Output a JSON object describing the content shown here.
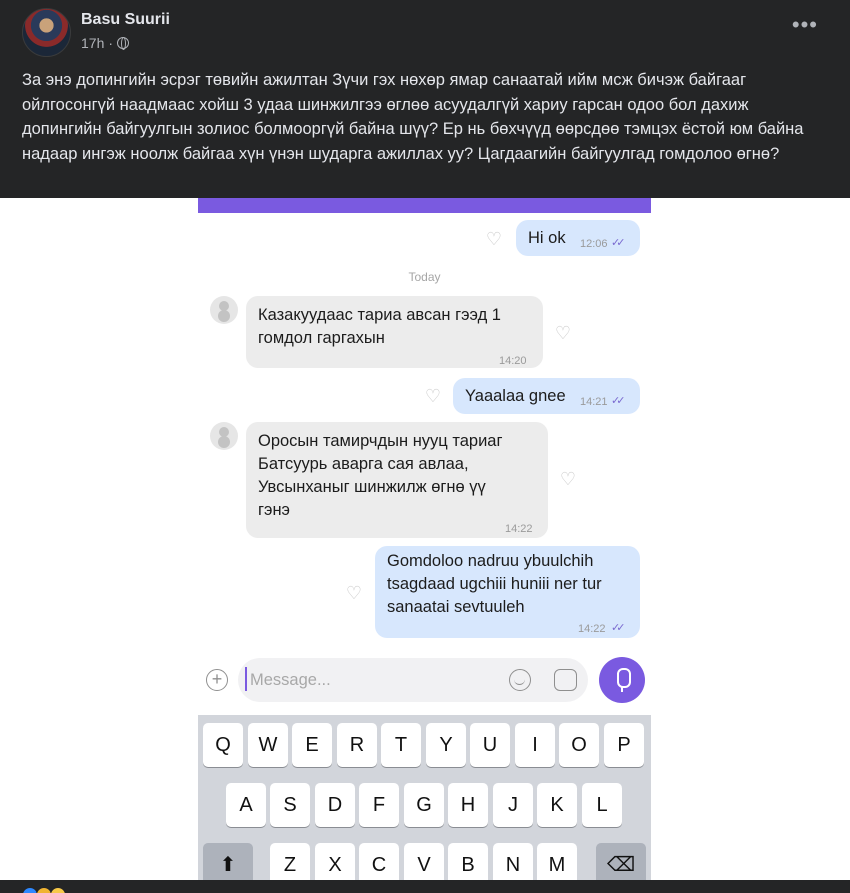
{
  "post": {
    "author": "Basu Suurii",
    "time": "17h",
    "text": "За энэ допингийн эсрэг төвийн ажилтан Зүчи гэх нөхөр ямар санаатай ийм мсж бичэж байгааг ойлгосонгүй наадмаас хойш 3 удаа шинжилгээ өглөө асуудалгүй хариу гарсан одоо бол дахиж допингийн байгуулгын золиос болмооргүй байна шүү? Ер нь бөхчүүд өөрсдөө тэмцэх ёстой юм байна надаар ингэж ноолж байгаа хүн үнэн шударга ажиллах уу? Цагдаагийн байгуулгад гомдолоо өгнө?"
  },
  "chat": {
    "day_label": "Today",
    "messages": [
      {
        "dir": "out",
        "text": "Hi ok",
        "time": "12:06"
      },
      {
        "dir": "in",
        "lines": [
          "Казакуудаас тариа авсан гээд 1",
          "гомдол гаргахын"
        ],
        "time": "14:20"
      },
      {
        "dir": "out",
        "text": "Yaaalaa gnee",
        "time": "14:21"
      },
      {
        "dir": "in",
        "lines": [
          "Оросын тамирчдын нууц тариаг",
          "Батсуурь аварга сая авлаа,",
          "Увсынханыг шинжилж өгнө үү",
          "гэнэ"
        ],
        "time": "14:22"
      },
      {
        "dir": "out",
        "lines": [
          "Gomdoloo nadruu ybuulchih",
          "tsagdaad ugchiii huniii ner tur",
          "sanaatai sevtuuleh"
        ],
        "time": "14:22"
      }
    ],
    "composer_placeholder": "Message...",
    "keyboard": {
      "row1": [
        "Q",
        "W",
        "E",
        "R",
        "T",
        "Y",
        "U",
        "I",
        "O",
        "P"
      ],
      "row2": [
        "A",
        "S",
        "D",
        "F",
        "G",
        "H",
        "J",
        "K",
        "L"
      ],
      "row3": [
        "Z",
        "X",
        "C",
        "V",
        "B",
        "N",
        "M"
      ]
    }
  },
  "icons": {
    "more": "more-horizontal-icon",
    "privacy": "globe-icon",
    "like": "heart-icon",
    "add": "plus-circle-icon",
    "emoji": "emoji-icon",
    "sticker": "sticker-icon",
    "mic": "microphone-icon",
    "shift": "shift-icon",
    "backspace": "backspace-icon"
  },
  "colors": {
    "facebook_bg": "#242526",
    "viber_purple": "#7a5ae0",
    "outgoing_bubble": "#d7e7fd",
    "incoming_bubble": "#ececec"
  }
}
